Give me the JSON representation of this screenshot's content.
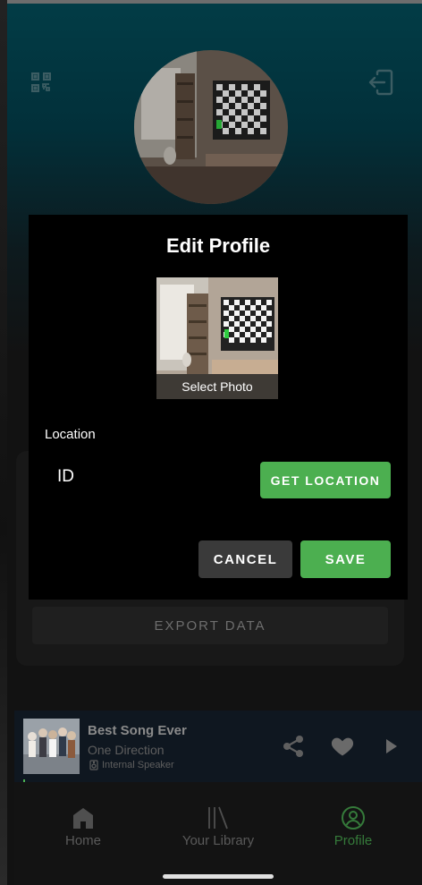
{
  "dialog": {
    "title": "Edit Profile",
    "photo_caption": "Select Photo",
    "location_label": "Location",
    "location_value": "ID",
    "get_location_label": "GET LOCATION",
    "cancel_label": "CANCEL",
    "save_label": "SAVE"
  },
  "settings": {
    "export_label": "EXPORT DATA"
  },
  "player": {
    "title": "Best Song Ever",
    "artist": "One Direction",
    "device": "Internal Speaker"
  },
  "nav": {
    "items": [
      {
        "label": "Home",
        "icon": "home-icon",
        "active": false
      },
      {
        "label": "Your Library",
        "icon": "library-icon",
        "active": false
      },
      {
        "label": "Profile",
        "icon": "profile-icon",
        "active": true
      }
    ]
  },
  "colors": {
    "accent": "#4caf50",
    "header_teal": "#023c46",
    "background": "#121212"
  }
}
